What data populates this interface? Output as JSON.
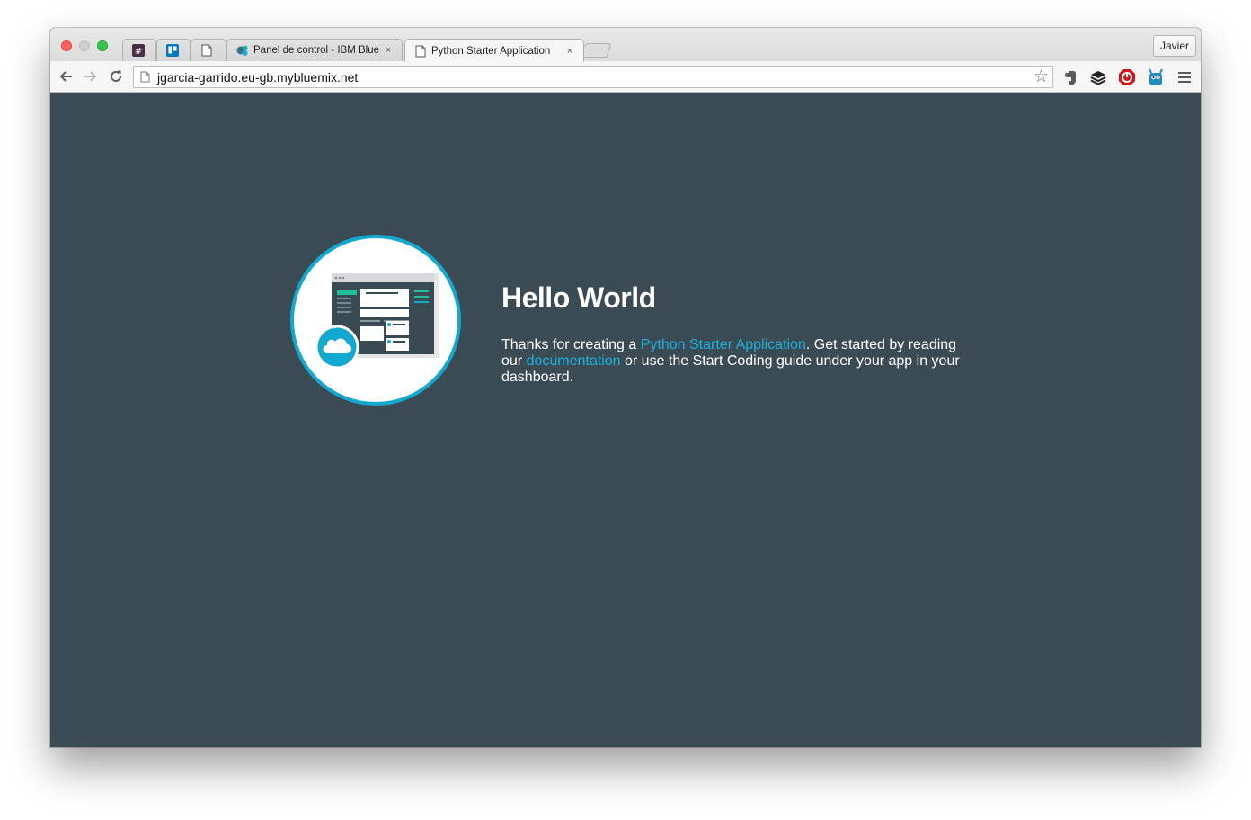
{
  "browser": {
    "tabs": [
      {
        "title": "",
        "icon": "slack-icon",
        "closable": false
      },
      {
        "title": "",
        "icon": "trello-icon",
        "closable": false
      },
      {
        "title": "",
        "icon": "page-icon",
        "closable": false
      },
      {
        "title": "Panel de control - IBM Blue",
        "icon": "bluemix-icon",
        "closable": true
      },
      {
        "title": "Python Starter Application",
        "icon": "page-icon",
        "closable": true,
        "active": true
      }
    ],
    "close_glyph": "×",
    "profile_name": "Javier",
    "url": "jgarcia-garrido.eu-gb.mybluemix.net",
    "extensions": [
      "evernote-icon",
      "buffer-icon",
      "adblock-icon",
      "extension-robot-icon"
    ],
    "menu_icon": "hamburger-icon"
  },
  "page": {
    "heading": "Hello World",
    "intro_before": "Thanks for creating a ",
    "app_link": "Python Starter Application",
    "intro_middle": ". Get started by reading our ",
    "docs_link": "documentation",
    "intro_after": " or use the Start Coding guide under your app in your dashboard.",
    "colors": {
      "background": "#3b4b54",
      "link": "#1cb2e0",
      "circle_border": "#13a8cf"
    },
    "hero_icon": "cloud-dashboard-icon"
  }
}
